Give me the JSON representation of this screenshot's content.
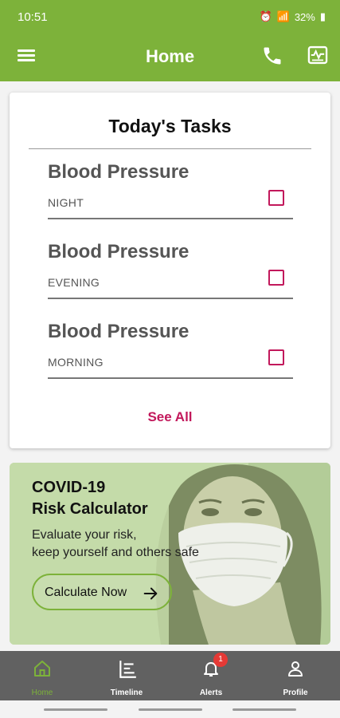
{
  "status_bar": {
    "time": "10:51",
    "battery": "32%"
  },
  "app_bar": {
    "title": "Home"
  },
  "tasks_card": {
    "title": "Today's Tasks",
    "tasks": [
      {
        "name": "Blood Pressure",
        "when": "NIGHT",
        "checked": false
      },
      {
        "name": "Blood Pressure",
        "when": "EVENING",
        "checked": false
      },
      {
        "name": "Blood Pressure",
        "when": "MORNING",
        "checked": false
      }
    ],
    "see_all_label": "See All"
  },
  "covid_banner": {
    "title_line1": "COVID-19",
    "title_line2": "Risk Calculator",
    "subtitle_line1": "Evaluate your risk,",
    "subtitle_line2": "keep yourself and others safe",
    "button_label": "Calculate Now"
  },
  "bottom_nav": {
    "items": [
      {
        "label": "Home",
        "icon": "home-icon",
        "active": true
      },
      {
        "label": "Timeline",
        "icon": "timeline-icon",
        "active": false
      },
      {
        "label": "Alerts",
        "icon": "bell-icon",
        "active": false,
        "badge": "1"
      },
      {
        "label": "Profile",
        "icon": "person-icon",
        "active": false
      }
    ]
  },
  "colors": {
    "primary": "#7db23a",
    "accent": "#c2185b",
    "nav_bg": "#616161"
  }
}
